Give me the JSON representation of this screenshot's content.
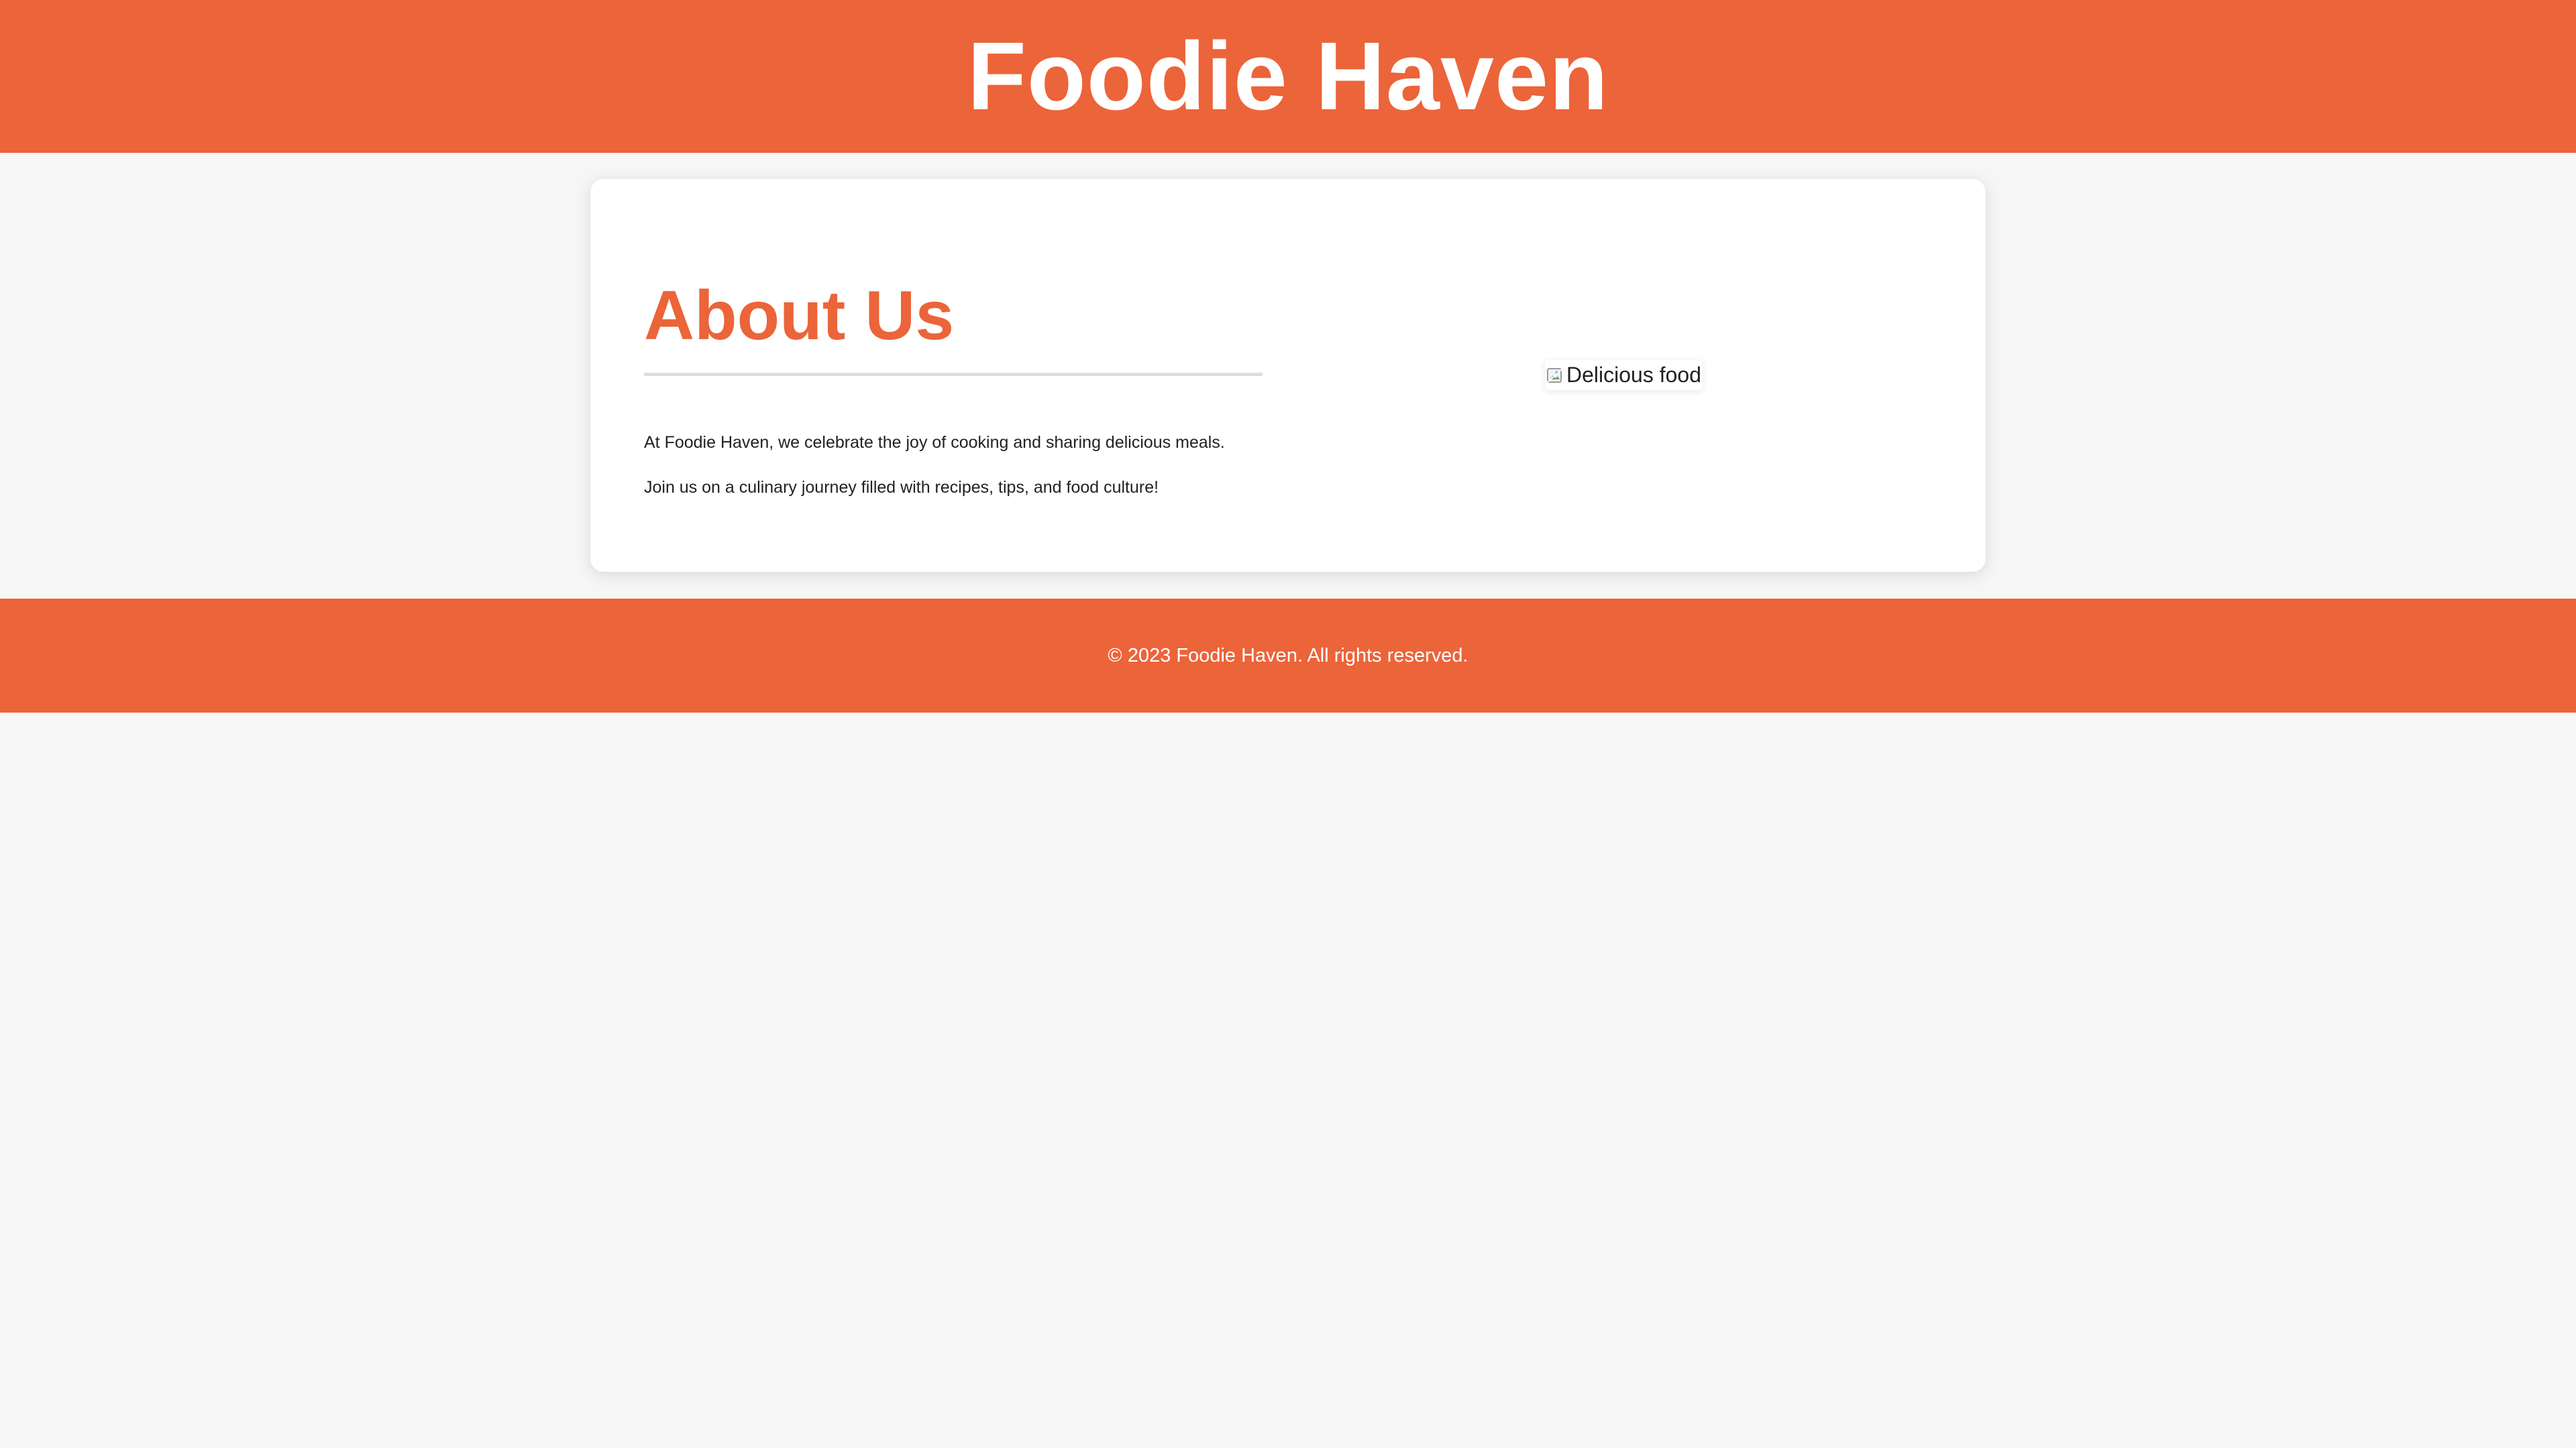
{
  "header": {
    "title": "Foodie Haven"
  },
  "about": {
    "heading": "About Us",
    "paragraphs": [
      "At Foodie Haven, we celebrate the joy of cooking and sharing delicious meals.",
      "Join us on a culinary journey filled with recipes, tips, and food culture!"
    ],
    "image_alt": "Delicious food",
    "image_icon": "broken-image-icon"
  },
  "footer": {
    "text": "© 2023 Foodie Haven. All rights reserved."
  },
  "colors": {
    "brand": "#ec6439",
    "page_background": "#f6f6f6",
    "card_background": "#ffffff",
    "footer_text": "#ffffff"
  }
}
